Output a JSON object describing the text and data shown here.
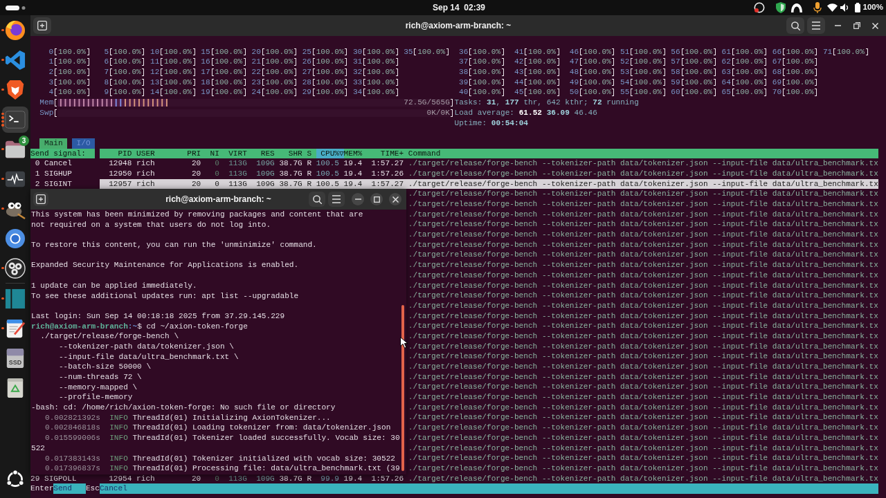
{
  "top_bar": {
    "clock": "Sep 14  02:39",
    "battery": "100%"
  },
  "dock": [
    {
      "kind": "globe",
      "running": true,
      "multiple_windows": false,
      "active": false
    },
    {
      "kind": "ribbon",
      "running": true,
      "multiple_windows": false,
      "active": false
    },
    {
      "kind": "shield",
      "running": true,
      "multiple_windows": false,
      "active": false
    },
    {
      "kind": "terminal",
      "running": true,
      "multiple_windows": true,
      "active": true
    },
    {
      "kind": "folder",
      "running": true,
      "multiple_windows": false,
      "active": false,
      "badge": "3"
    },
    {
      "kind": "monitor",
      "running": true,
      "multiple_windows": false,
      "active": false
    },
    {
      "kind": "mascot",
      "running": true,
      "multiple_windows": false,
      "active": false
    },
    {
      "kind": "ring",
      "running": false,
      "active": false
    },
    {
      "kind": "aperture",
      "running": true,
      "multiple_windows": false,
      "active": false
    },
    {
      "kind": "separator"
    },
    {
      "kind": "panels",
      "running": true,
      "multiple_windows": false,
      "active": false
    },
    {
      "kind": "notepad",
      "running": true,
      "multiple_windows": false,
      "active": false
    },
    {
      "kind": "drive",
      "running": false,
      "active": false,
      "label": "SSD"
    },
    {
      "kind": "trash",
      "running": false,
      "active": false
    }
  ],
  "main_window": {
    "title": "rich@axiom-arm-branch: ~",
    "htop": {
      "cpus": [
        {
          "label": "0",
          "value": "100.0%"
        },
        {
          "label": "1",
          "value": "100.0%"
        },
        {
          "label": "2",
          "value": "100.0%"
        },
        {
          "label": "3",
          "value": "100.0%"
        },
        {
          "label": "4",
          "value": "100.0%"
        },
        {
          "label": "5",
          "value": "100.0%"
        },
        {
          "label": "6",
          "value": "100.0%"
        },
        {
          "label": "7",
          "value": "100.0%"
        },
        {
          "label": "8",
          "value": "100.0%"
        },
        {
          "label": "9",
          "value": "100.0%"
        },
        {
          "label": "10",
          "value": "100.0%"
        },
        {
          "label": "11",
          "value": "100.0%"
        },
        {
          "label": "12",
          "value": "100.0%"
        },
        {
          "label": "13",
          "value": "100.0%"
        },
        {
          "label": "14",
          "value": "100.0%"
        },
        {
          "label": "15",
          "value": "100.0%"
        },
        {
          "label": "16",
          "value": "100.0%"
        },
        {
          "label": "17",
          "value": "100.0%"
        },
        {
          "label": "18",
          "value": "100.0%"
        },
        {
          "label": "19",
          "value": "100.0%"
        },
        {
          "label": "20",
          "value": "100.0%"
        },
        {
          "label": "21",
          "value": "100.0%"
        },
        {
          "label": "22",
          "value": "100.0%"
        },
        {
          "label": "23",
          "value": "100.0%"
        },
        {
          "label": "24",
          "value": "100.0%"
        },
        {
          "label": "25",
          "value": "100.0%"
        },
        {
          "label": "26",
          "value": "100.0%"
        },
        {
          "label": "27",
          "value": "100.0%"
        },
        {
          "label": "28",
          "value": "100.0%"
        },
        {
          "label": "29",
          "value": "100.0%"
        },
        {
          "label": "30",
          "value": "100.0%"
        },
        {
          "label": "31",
          "value": "100.0%"
        },
        {
          "label": "32",
          "value": "100.0%"
        },
        {
          "label": "33",
          "value": "100.0%"
        },
        {
          "label": "34",
          "value": "100.0%"
        },
        {
          "label": "35",
          "value": "100.0%"
        },
        {
          "label": "36",
          "value": "100.0%"
        },
        {
          "label": "37",
          "value": "100.0%"
        },
        {
          "label": "38",
          "value": "100.0%"
        },
        {
          "label": "39",
          "value": "100.0%"
        },
        {
          "label": "40",
          "value": "100.0%"
        },
        {
          "label": "41",
          "value": "100.0%"
        },
        {
          "label": "42",
          "value": "100.0%"
        },
        {
          "label": "43",
          "value": "100.0%"
        },
        {
          "label": "44",
          "value": "100.0%"
        },
        {
          "label": "45",
          "value": "100.0%"
        },
        {
          "label": "46",
          "value": "100.0%"
        },
        {
          "label": "47",
          "value": "100.0%"
        },
        {
          "label": "48",
          "value": "100.0%"
        },
        {
          "label": "49",
          "value": "100.0%"
        },
        {
          "label": "50",
          "value": "100.0%"
        },
        {
          "label": "51",
          "value": "100.0%"
        },
        {
          "label": "52",
          "value": "100.0%"
        },
        {
          "label": "53",
          "value": "100.0%"
        },
        {
          "label": "54",
          "value": "100.0%"
        },
        {
          "label": "55",
          "value": "100.0%"
        },
        {
          "label": "56",
          "value": "100.0%"
        },
        {
          "label": "57",
          "value": "100.0%"
        },
        {
          "label": "58",
          "value": "100.0%"
        },
        {
          "label": "59",
          "value": "100.0%"
        },
        {
          "label": "60",
          "value": "100.0%"
        },
        {
          "label": "61",
          "value": "100.0%"
        },
        {
          "label": "62",
          "value": "100.0%"
        },
        {
          "label": "63",
          "value": "100.0%"
        },
        {
          "label": "64",
          "value": "100.0%"
        },
        {
          "label": "65",
          "value": "100.0%"
        },
        {
          "label": "66",
          "value": "100.0%"
        },
        {
          "label": "67",
          "value": "100.0%"
        },
        {
          "label": "68",
          "value": "100.0%"
        },
        {
          "label": "69",
          "value": "100.0%"
        },
        {
          "label": "70",
          "value": "100.0%"
        },
        {
          "label": "71",
          "value": "100.0%"
        }
      ],
      "memory": {
        "label": "Mem",
        "level": 0.28,
        "reading": "72.5G/565G"
      },
      "swap": {
        "label": "Swp",
        "reading": "0K/0K"
      },
      "tasks": "Tasks: **31**, **177** thr, 642 kthr; **72** running",
      "load_average": "Load average: **61.52** **36.09** 46.46",
      "uptime": "Uptime: **00:54:04**",
      "tabs": [
        {
          "label": "Main",
          "selected": true
        },
        {
          "label": "I/O",
          "selected": false
        }
      ],
      "signal_panel_title": "Send signal:",
      "columns": [
        {
          "label": "PID",
          "sorted": false
        },
        {
          "label": "USER",
          "sorted": false
        },
        {
          "label": "PRI",
          "sorted": false
        },
        {
          "label": "NI",
          "sorted": false
        },
        {
          "label": "VIRT",
          "sorted": false
        },
        {
          "label": "RES",
          "sorted": false
        },
        {
          "label": "SHR",
          "sorted": false
        },
        {
          "label": "S",
          "sorted": false
        },
        {
          "label": "CPU%▽",
          "sorted": true
        },
        {
          "label": "MEM%",
          "sorted": false
        },
        {
          "label": "TIME+",
          "sorted": false
        },
        {
          "label": "Command",
          "sorted": false
        }
      ],
      "rows": [
        {
          "signal": {
            "number": "0",
            "name": "Cancel"
          },
          "pid": "12948",
          "user": "rich",
          "pri": "20",
          "ni": "0",
          "virt": "113G",
          "res": "109G",
          "shr": "38.7G",
          "s": "R",
          "cpu_percent": "100.5",
          "mem_percent": "19.4",
          "time": "1:57.27",
          "command": "./target/release/forge-bench --tokenizer-path data/tokenizer.json --input-file data/ultra_benchmark.tx",
          "selected": false
        },
        {
          "signal": {
            "number": "1",
            "name": "SIGHUP"
          },
          "pid": "12950",
          "user": "rich",
          "pri": "20",
          "ni": "0",
          "virt": "113G",
          "res": "109G",
          "shr": "38.7G",
          "s": "R",
          "cpu_percent": "100.5",
          "mem_percent": "19.4",
          "time": "1:57.26",
          "command": "./target/release/forge-bench --tokenizer-path data/tokenizer.json --input-file data/ultra_benchmark.tx",
          "selected": false
        },
        {
          "signal": {
            "number": "2",
            "name": "SIGINT"
          },
          "pid": "12957",
          "user": "rich",
          "pri": "20",
          "ni": "0",
          "virt": "113G",
          "res": "109G",
          "shr": "38.7G",
          "s": "R",
          "cpu_percent": "100.5",
          "mem_percent": "19.4",
          "time": "1:57.27",
          "command": "./target/release/forge-bench --tokenizer-path data/tokenizer.json --input-file data/ultra_benchmark.tx",
          "selected": true
        },
        {
          "command": "./target/release/forge-bench --tokenizer-path data/tokenizer.json --input-file data/ultra_benchmark.tx",
          "selected": false
        },
        {
          "command": "./target/release/forge-bench --tokenizer-path data/tokenizer.json --input-file data/ultra_benchmark.tx",
          "selected": false
        },
        {
          "command": "./target/release/forge-bench --tokenizer-path data/tokenizer.json --input-file data/ultra_benchmark.tx",
          "selected": false
        },
        {
          "command": "./target/release/forge-bench --tokenizer-path data/tokenizer.json --input-file data/ultra_benchmark.tx",
          "selected": false
        },
        {
          "command": "./target/release/forge-bench --tokenizer-path data/tokenizer.json --input-file data/ultra_benchmark.tx",
          "selected": false
        },
        {
          "command": "./target/release/forge-bench --tokenizer-path data/tokenizer.json --input-file data/ultra_benchmark.tx",
          "selected": false
        },
        {
          "command": "./target/release/forge-bench --tokenizer-path data/tokenizer.json --input-file data/ultra_benchmark.tx",
          "selected": false
        },
        {
          "command": "./target/release/forge-bench --tokenizer-path data/tokenizer.json --input-file data/ultra_benchmark.tx",
          "selected": false
        },
        {
          "command": "./target/release/forge-bench --tokenizer-path data/tokenizer.json --input-file data/ultra_benchmark.tx",
          "selected": false
        },
        {
          "command": "./target/release/forge-bench --tokenizer-path data/tokenizer.json --input-file data/ultra_benchmark.tx",
          "selected": false
        },
        {
          "command": "./target/release/forge-bench --tokenizer-path data/tokenizer.json --input-file data/ultra_benchmark.tx",
          "selected": false
        },
        {
          "command": "./target/release/forge-bench --tokenizer-path data/tokenizer.json --input-file data/ultra_benchmark.tx",
          "selected": false
        },
        {
          "command": "./target/release/forge-bench --tokenizer-path data/tokenizer.json --input-file data/ultra_benchmark.tx",
          "selected": false
        },
        {
          "command": "./target/release/forge-bench --tokenizer-path data/tokenizer.json --input-file data/ultra_benchmark.tx",
          "selected": false
        },
        {
          "command": "./target/release/forge-bench --tokenizer-path data/tokenizer.json --input-file data/ultra_benchmark.tx",
          "selected": false
        },
        {
          "command": "./target/release/forge-bench --tokenizer-path data/tokenizer.json --input-file data/ultra_benchmark.tx",
          "selected": false
        },
        {
          "command": "./target/release/forge-bench --tokenizer-path data/tokenizer.json --input-file data/ultra_benchmark.tx",
          "selected": false
        },
        {
          "command": "./target/release/forge-bench --tokenizer-path data/tokenizer.json --input-file data/ultra_benchmark.tx",
          "selected": false
        },
        {
          "command": "./target/release/forge-bench --tokenizer-path data/tokenizer.json --input-file data/ultra_benchmark.tx",
          "selected": false
        },
        {
          "command": "./target/release/forge-bench --tokenizer-path data/tokenizer.json --input-file data/ultra_benchmark.tx",
          "selected": false
        },
        {
          "command": "./target/release/forge-bench --tokenizer-path data/tokenizer.json --input-file data/ultra_benchmark.tx",
          "selected": false
        },
        {
          "command": "./target/release/forge-bench --tokenizer-path data/tokenizer.json --input-file data/ultra_benchmark.tx",
          "selected": false
        },
        {
          "command": "./target/release/forge-bench --tokenizer-path data/tokenizer.json --input-file data/ultra_benchmark.tx",
          "selected": false
        },
        {
          "command": "./target/release/forge-bench --tokenizer-path data/tokenizer.json --input-file data/ultra_benchmark.tx",
          "selected": false
        },
        {
          "command": "./target/release/forge-bench --tokenizer-path data/tokenizer.json --input-file data/ultra_benchmark.tx",
          "selected": false
        },
        {
          "command": "./target/release/forge-bench --tokenizer-path data/tokenizer.json --input-file data/ultra_benchmark.tx",
          "selected": false
        },
        {
          "command": "./target/release/forge-bench --tokenizer-path data/tokenizer.json --input-file data/ultra_benchmark.tx",
          "selected": false
        },
        {
          "command": "./target/release/forge-bench --tokenizer-path data/tokenizer.json --input-file data/ultra_benchmark.tx",
          "selected": false
        },
        {
          "signal": {
            "number": "29",
            "name": "SIGPOLL"
          },
          "pid": "12954",
          "user": "rich",
          "pri": "20",
          "ni": "0",
          "virt": "113G",
          "res": "109G",
          "shr": "38.7G",
          "s": "R",
          "cpu_percent": "99.9",
          "mem_percent": "19.4",
          "time": "1:57.26",
          "command": "./target/release/forge-bench --tokenizer-path data/tokenizer.json --input-file data/ultra_benchmark.tx",
          "selected": false
        }
      ],
      "function_bar": [
        {
          "key": "Enter",
          "label": "Send"
        },
        {
          "key": "Esc",
          "label": "Cancel"
        }
      ]
    }
  },
  "overlay_window": {
    "title": "rich@axiom-arm-branch: ~",
    "paragraphs": [
      [
        {
          "kind": "text",
          "text": "This system has been minimized by removing packages and content that are"
        },
        {
          "kind": "text",
          "text": "not required on a system that users do not log into."
        }
      ],
      [
        {
          "kind": "text",
          "text": "To restore this content, you can run the 'unminimize' command."
        }
      ],
      [
        {
          "kind": "text",
          "text": "Expanded Security Maintenance for Applications is enabled."
        }
      ],
      [
        {
          "kind": "text",
          "text": "1 update can be applied immediately."
        },
        {
          "kind": "text",
          "text": "To see these additional updates run: apt list --upgradable"
        }
      ],
      [
        {
          "kind": "text",
          "text": "Last login: Sun Sep 14 00:18:18 2025 from 37.29.145.229"
        },
        {
          "kind": "prompt",
          "user_host": "rich@axiom-arm-branch",
          "path": ":~",
          "command": "$ cd ~/axion-token-forge"
        },
        {
          "kind": "command",
          "text": "./target/release/forge-bench \\"
        },
        {
          "kind": "option",
          "text": "--tokenizer-path data/tokenizer.json \\"
        },
        {
          "kind": "option",
          "text": "--input-file data/ultra_benchmark.txt \\"
        },
        {
          "kind": "option",
          "text": "--batch-size 50000 \\"
        },
        {
          "kind": "option",
          "text": "--num-threads 72 \\"
        },
        {
          "kind": "option",
          "text": "--memory-mapped \\"
        },
        {
          "kind": "option",
          "text": "--profile-memory"
        },
        {
          "kind": "text",
          "text": "-bash: cd: /home/rich/axion-token-forge: No such file or directory"
        },
        {
          "kind": "log",
          "time": "0.002821392s",
          "severity": "INFO",
          "message": "ThreadId(01) Initializing AxionTokenizer..."
        },
        {
          "kind": "log",
          "time": "0.002846818s",
          "severity": "INFO",
          "message": "ThreadId(01) Loading tokenizer from: data/tokenizer.json"
        },
        {
          "kind": "log",
          "time": "0.015599006s",
          "severity": "INFO",
          "message": "ThreadId(01) Tokenizer loaded successfully. Vocab size: 30"
        },
        {
          "kind": "text",
          "text": "522"
        },
        {
          "kind": "log",
          "time": "0.017383143s",
          "severity": "INFO",
          "message": "ThreadId(01) Tokenizer initialized with vocab size: 30522"
        },
        {
          "kind": "log",
          "time": "0.017396837s",
          "severity": "INFO",
          "message": "ThreadId(01) Processing file: data/ultra_benchmark.txt (39"
        }
      ]
    ]
  }
}
